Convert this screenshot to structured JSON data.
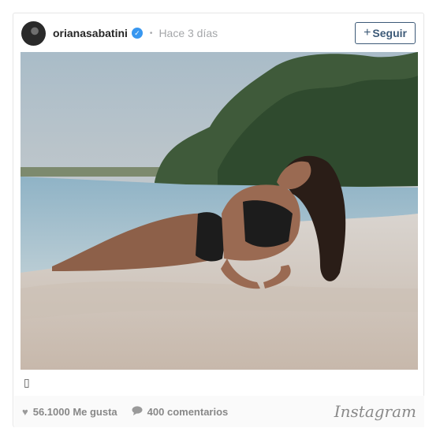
{
  "post": {
    "username": "orianasabatini",
    "verified_icon": "verified-check-icon",
    "separator": "•",
    "time": "Hace 3 días",
    "follow_label": "Seguir",
    "follow_icon": "+",
    "caption": "▯"
  },
  "footer": {
    "likes": "56.1000 Me gusta",
    "likes_icon": "heart-icon",
    "comments": "400 comentarios",
    "comments_icon": "comment-bubble-icon",
    "brand": "Instagram"
  },
  "colors": {
    "accent": "#3d5a78",
    "verified": "#3897f0",
    "muted": "#a5a7aa"
  }
}
